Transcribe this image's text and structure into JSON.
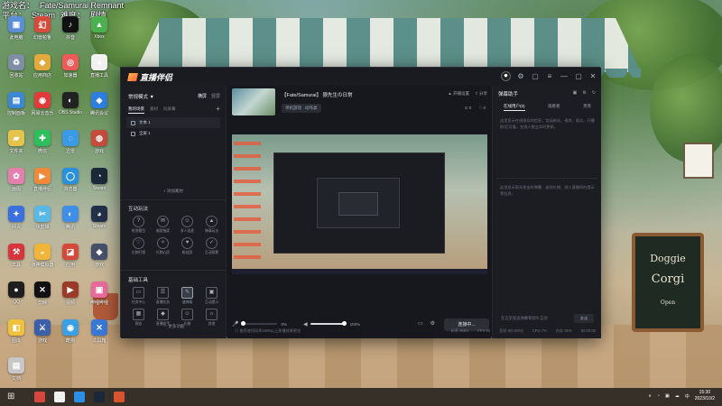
{
  "desktop": {
    "overlay": {
      "line1_label": "游戏名：",
      "line1_value": "Fate/Samurai Remnant",
      "line2_label": "平台：",
      "line2_value": "Steam",
      "line3_label": "难度：",
      "line3_value": "剧情"
    },
    "icons": [
      {
        "label": "此电脑",
        "color": "#5a8fd6",
        "glyph": "▣",
        "icon": "computer-icon"
      },
      {
        "label": "幻兽帕鲁",
        "color": "#d64b3a",
        "glyph": "幻",
        "icon": "app-icon"
      },
      {
        "label": "抖音",
        "color": "#111111",
        "glyph": "♪",
        "icon": "tiktok-icon"
      },
      {
        "label": "Xbox",
        "color": "#4caf50",
        "glyph": "▲",
        "icon": "xbox-icon"
      },
      {
        "label": "回收站",
        "color": "#7d8ea5",
        "glyph": "♻",
        "icon": "recycle-bin-icon"
      },
      {
        "label": "应用商店",
        "color": "#e2a93c",
        "glyph": "◆",
        "icon": "store-icon"
      },
      {
        "label": "加速器",
        "color": "#ef5b5b",
        "glyph": "◎",
        "icon": "accelerator-icon"
      },
      {
        "label": "直播工具",
        "color": "#f2f2f2",
        "glyph": "●",
        "icon": "live-tool-icon"
      },
      {
        "label": "控制面板",
        "color": "#3d87d8",
        "glyph": "▤",
        "icon": "control-panel-icon"
      },
      {
        "label": "网易云音乐",
        "color": "#e33b3b",
        "glyph": "◉",
        "icon": "music-icon"
      },
      {
        "label": "OBS Studio",
        "color": "#222222",
        "glyph": "◐",
        "icon": "obs-icon"
      },
      {
        "label": "腾讯会议",
        "color": "#2f7fe0",
        "glyph": "◈",
        "icon": "meeting-icon"
      },
      {
        "label": "文件夹",
        "color": "#e6c34b",
        "glyph": "▰",
        "icon": "folder-icon"
      },
      {
        "label": "微信",
        "color": "#2dbf5b",
        "glyph": "✚",
        "icon": "wechat-icon"
      },
      {
        "label": "迅雷",
        "color": "#3b9ae6",
        "glyph": "◌",
        "icon": "thunder-icon"
      },
      {
        "label": "游戏",
        "color": "#c94c3c",
        "glyph": "◍",
        "icon": "game-icon"
      },
      {
        "label": "画图",
        "color": "#e57fb0",
        "glyph": "✿",
        "icon": "paint-icon"
      },
      {
        "label": "直播伴侣",
        "color": "#f08a3a",
        "glyph": "▶",
        "icon": "live-companion-icon"
      },
      {
        "label": "浏览器",
        "color": "#2a8fdc",
        "glyph": "◯",
        "icon": "browser-icon"
      },
      {
        "label": "Steam",
        "color": "#1b2838",
        "glyph": "◔",
        "icon": "steam-icon"
      },
      {
        "label": "网页",
        "color": "#3a6fe0",
        "glyph": "✦",
        "icon": "web-icon"
      },
      {
        "label": "快剪辑",
        "color": "#58b8e6",
        "glyph": "✂",
        "icon": "edit-icon"
      },
      {
        "label": "腾讯",
        "color": "#3f8ee8",
        "glyph": "◐",
        "icon": "tencent-icon"
      },
      {
        "label": "Steam",
        "color": "#23304a",
        "glyph": "◕",
        "icon": "steam-icon"
      },
      {
        "label": "工具",
        "color": "#d8343c",
        "glyph": "⚒",
        "icon": "tool-icon"
      },
      {
        "label": "夜神模拟器",
        "color": "#f0b53a",
        "glyph": "◒",
        "icon": "emulator-icon"
      },
      {
        "label": "应用",
        "color": "#d44a3a",
        "glyph": "◪",
        "icon": "app-icon"
      },
      {
        "label": "游戏",
        "color": "#46506a",
        "glyph": "◆",
        "icon": "game-icon"
      },
      {
        "label": "QQ",
        "color": "#1e1e1e",
        "glyph": "●",
        "icon": "qq-icon"
      },
      {
        "label": "剪映",
        "color": "#111111",
        "glyph": "✕",
        "icon": "capcut-icon"
      },
      {
        "label": "视频",
        "color": "#9a3b2a",
        "glyph": "▶",
        "icon": "video-icon"
      },
      {
        "label": "哔哩哔哩",
        "color": "#ea6a9b",
        "glyph": "▣",
        "icon": "bilibili-icon"
      },
      {
        "label": "图库",
        "color": "#f0c13a",
        "glyph": "◧",
        "icon": "gallery-icon"
      },
      {
        "label": "游戏",
        "color": "#3b5fa8",
        "glyph": "⚔",
        "icon": "game-icon"
      },
      {
        "label": "酷狗",
        "color": "#3aa0e6",
        "glyph": "◉",
        "icon": "music-icon"
      },
      {
        "label": "工具箱",
        "color": "#3a78d6",
        "glyph": "✕",
        "icon": "toolbox-icon"
      },
      {
        "label": "文档",
        "color": "#c7c7c7",
        "glyph": "▤",
        "icon": "document-icon"
      }
    ],
    "signboard": {
      "line1": "Doggie",
      "line2": "Corgi",
      "line3": "Open"
    }
  },
  "app": {
    "title": "直播伴侣",
    "window_controls": [
      "⚙",
      "▢",
      "≡",
      "—",
      "▢",
      "✕"
    ],
    "left": {
      "mode_label": "常规模式 ▼",
      "mode_tabs": [
        "横屏",
        "竖屏"
      ],
      "scene_tabs": [
        "我的场景",
        "素材",
        "同屏幕"
      ],
      "scene_plus": "+",
      "scenes": [
        "文本 1",
        "全屏 1"
      ],
      "add_source": "+ 添加素材",
      "section_interact": "互动玩法",
      "interact_tools": [
        {
          "label": "抢答题目",
          "glyph": "?"
        },
        {
          "label": "福袋抽奖",
          "glyph": "✉"
        },
        {
          "label": "多人连麦",
          "glyph": "☺"
        },
        {
          "label": "弹幕玩法",
          "glyph": "▲"
        },
        {
          "label": "礼物打榜",
          "glyph": "♡"
        },
        {
          "label": "礼物心愿",
          "glyph": "✧"
        },
        {
          "label": "粉丝团",
          "glyph": "♥"
        },
        {
          "label": "互动投票",
          "glyph": "✓"
        }
      ],
      "section_basic": "基础工具",
      "basic_tools": [
        {
          "label": "任务中心",
          "glyph": "▭"
        },
        {
          "label": "直播任务",
          "glyph": "☰"
        },
        {
          "label": "速弹幕",
          "glyph": "✎"
        },
        {
          "label": "互动提示",
          "glyph": "▣"
        },
        {
          "label": "预告",
          "glyph": "▦"
        },
        {
          "label": "直播助手",
          "glyph": "◆"
        },
        {
          "label": "礼物",
          "glyph": "☺"
        },
        {
          "label": "其他",
          "glyph": "☼"
        }
      ],
      "more": "⋯ 更多功能"
    },
    "center": {
      "room_title": "【Fate/Samurai】 狼先生の日常",
      "room_tag": "单机游戏 · 动作类",
      "actions": [
        "▲ 开播设置",
        "⇪ 分享"
      ],
      "stats": [
        "⊙ 0",
        "♡ 0"
      ],
      "mic_icon": "🎤",
      "mic_pct": "0%",
      "mic_level": 0,
      "speaker_pct": "100%",
      "speaker_level": 1,
      "live_button": "连接中..."
    },
    "right": {
      "title": "弹幕助手",
      "tabs": [
        "在线用户(0)",
        "观看者",
        "贵宾"
      ],
      "hint": "这里显示在线观众的信息，包括粉丝、贵宾、观众，开播前/后可看，在线人数会实时更新。",
      "hint2": "这里显示观众发出的弹幕、送的礼物、进入直播间的提示等信息。",
      "input_placeholder": "在这里发送弹幕和观众互动",
      "send": "发送"
    },
    "status": {
      "left": "◎ 推荐使用码率1800以上直播效果更佳",
      "items": [
        "码率 0kb/s",
        "FPS 60",
        "丢帧 0(0.00%)",
        "CPU 7%",
        "内存 36%",
        "00:00:00"
      ]
    }
  },
  "taskbar": {
    "start_glyph": "⊞",
    "apps": [
      "#d7463e",
      "#f1f1f1",
      "#2b8fe5",
      "#1b2838",
      "#d9532f"
    ],
    "tray": [
      "∧",
      "◔",
      "▣",
      "☁",
      "中"
    ],
    "time": "15:30",
    "date": "2023/10/2"
  }
}
